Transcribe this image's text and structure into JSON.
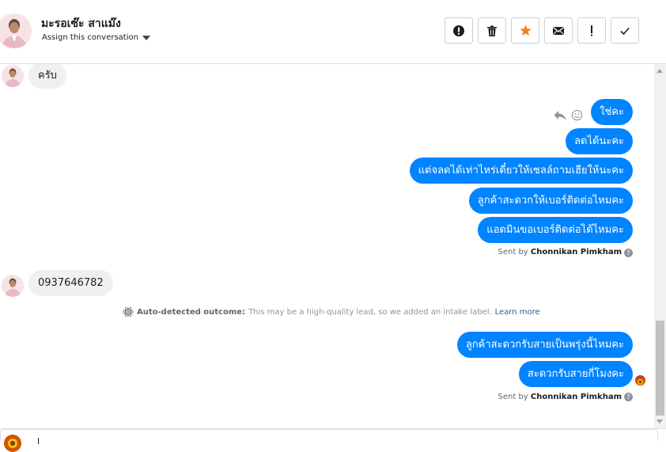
{
  "header": {
    "contact_name": "มะรอเซ๊ะ สาแม๊ง",
    "assign_label": "Assign this conversation",
    "actions": [
      {
        "icon": "alert-circle-icon",
        "name": "mark-spam-button"
      },
      {
        "icon": "trash-icon",
        "name": "delete-button"
      },
      {
        "icon": "star-icon",
        "name": "star-button",
        "color": "#f5821f"
      },
      {
        "icon": "envelope-icon",
        "name": "mark-unread-button"
      },
      {
        "icon": "exclamation-icon",
        "name": "follow-up-button"
      },
      {
        "icon": "checkmark-icon",
        "name": "mark-done-button"
      }
    ]
  },
  "thread": {
    "incoming_1": "ครับ",
    "outgoing_group_1": [
      "ใช่คะ",
      "ลดได้นะคะ",
      "แต่จลดได้เท่าไหร่เดี๋ยวให้เซลล์ถามเฮียให้นะคะ",
      "ลูกค้าสะดวกให้เบอร์ติดต่อไหมคะ",
      "แอดมินขอเบอร์ติดต่อได้ไหมคะ"
    ],
    "sent_by_prefix": "Sent by",
    "sent_by_name": "Chonnikan Pimkham",
    "incoming_2": "0937646782",
    "outcome_label": "Auto-detected outcome:",
    "outcome_text": "This may be a high-quality lead, so we added an intake label.",
    "outcome_link": "Learn more",
    "outgoing_group_2": [
      "ลูกค้าสะดวกรับสายเป็นพรุ่งนี้ไหมคะ",
      "สะดวกรับสายกี่โมงคะ"
    ],
    "sent_by_prefix_2": "Sent by",
    "sent_by_name_2": "Chonnikan Pimkham",
    "help_glyph": "?"
  },
  "colors": {
    "outgoing_bubble": "#0084ff",
    "incoming_bubble": "#f1f0f0",
    "star": "#f5821f"
  }
}
